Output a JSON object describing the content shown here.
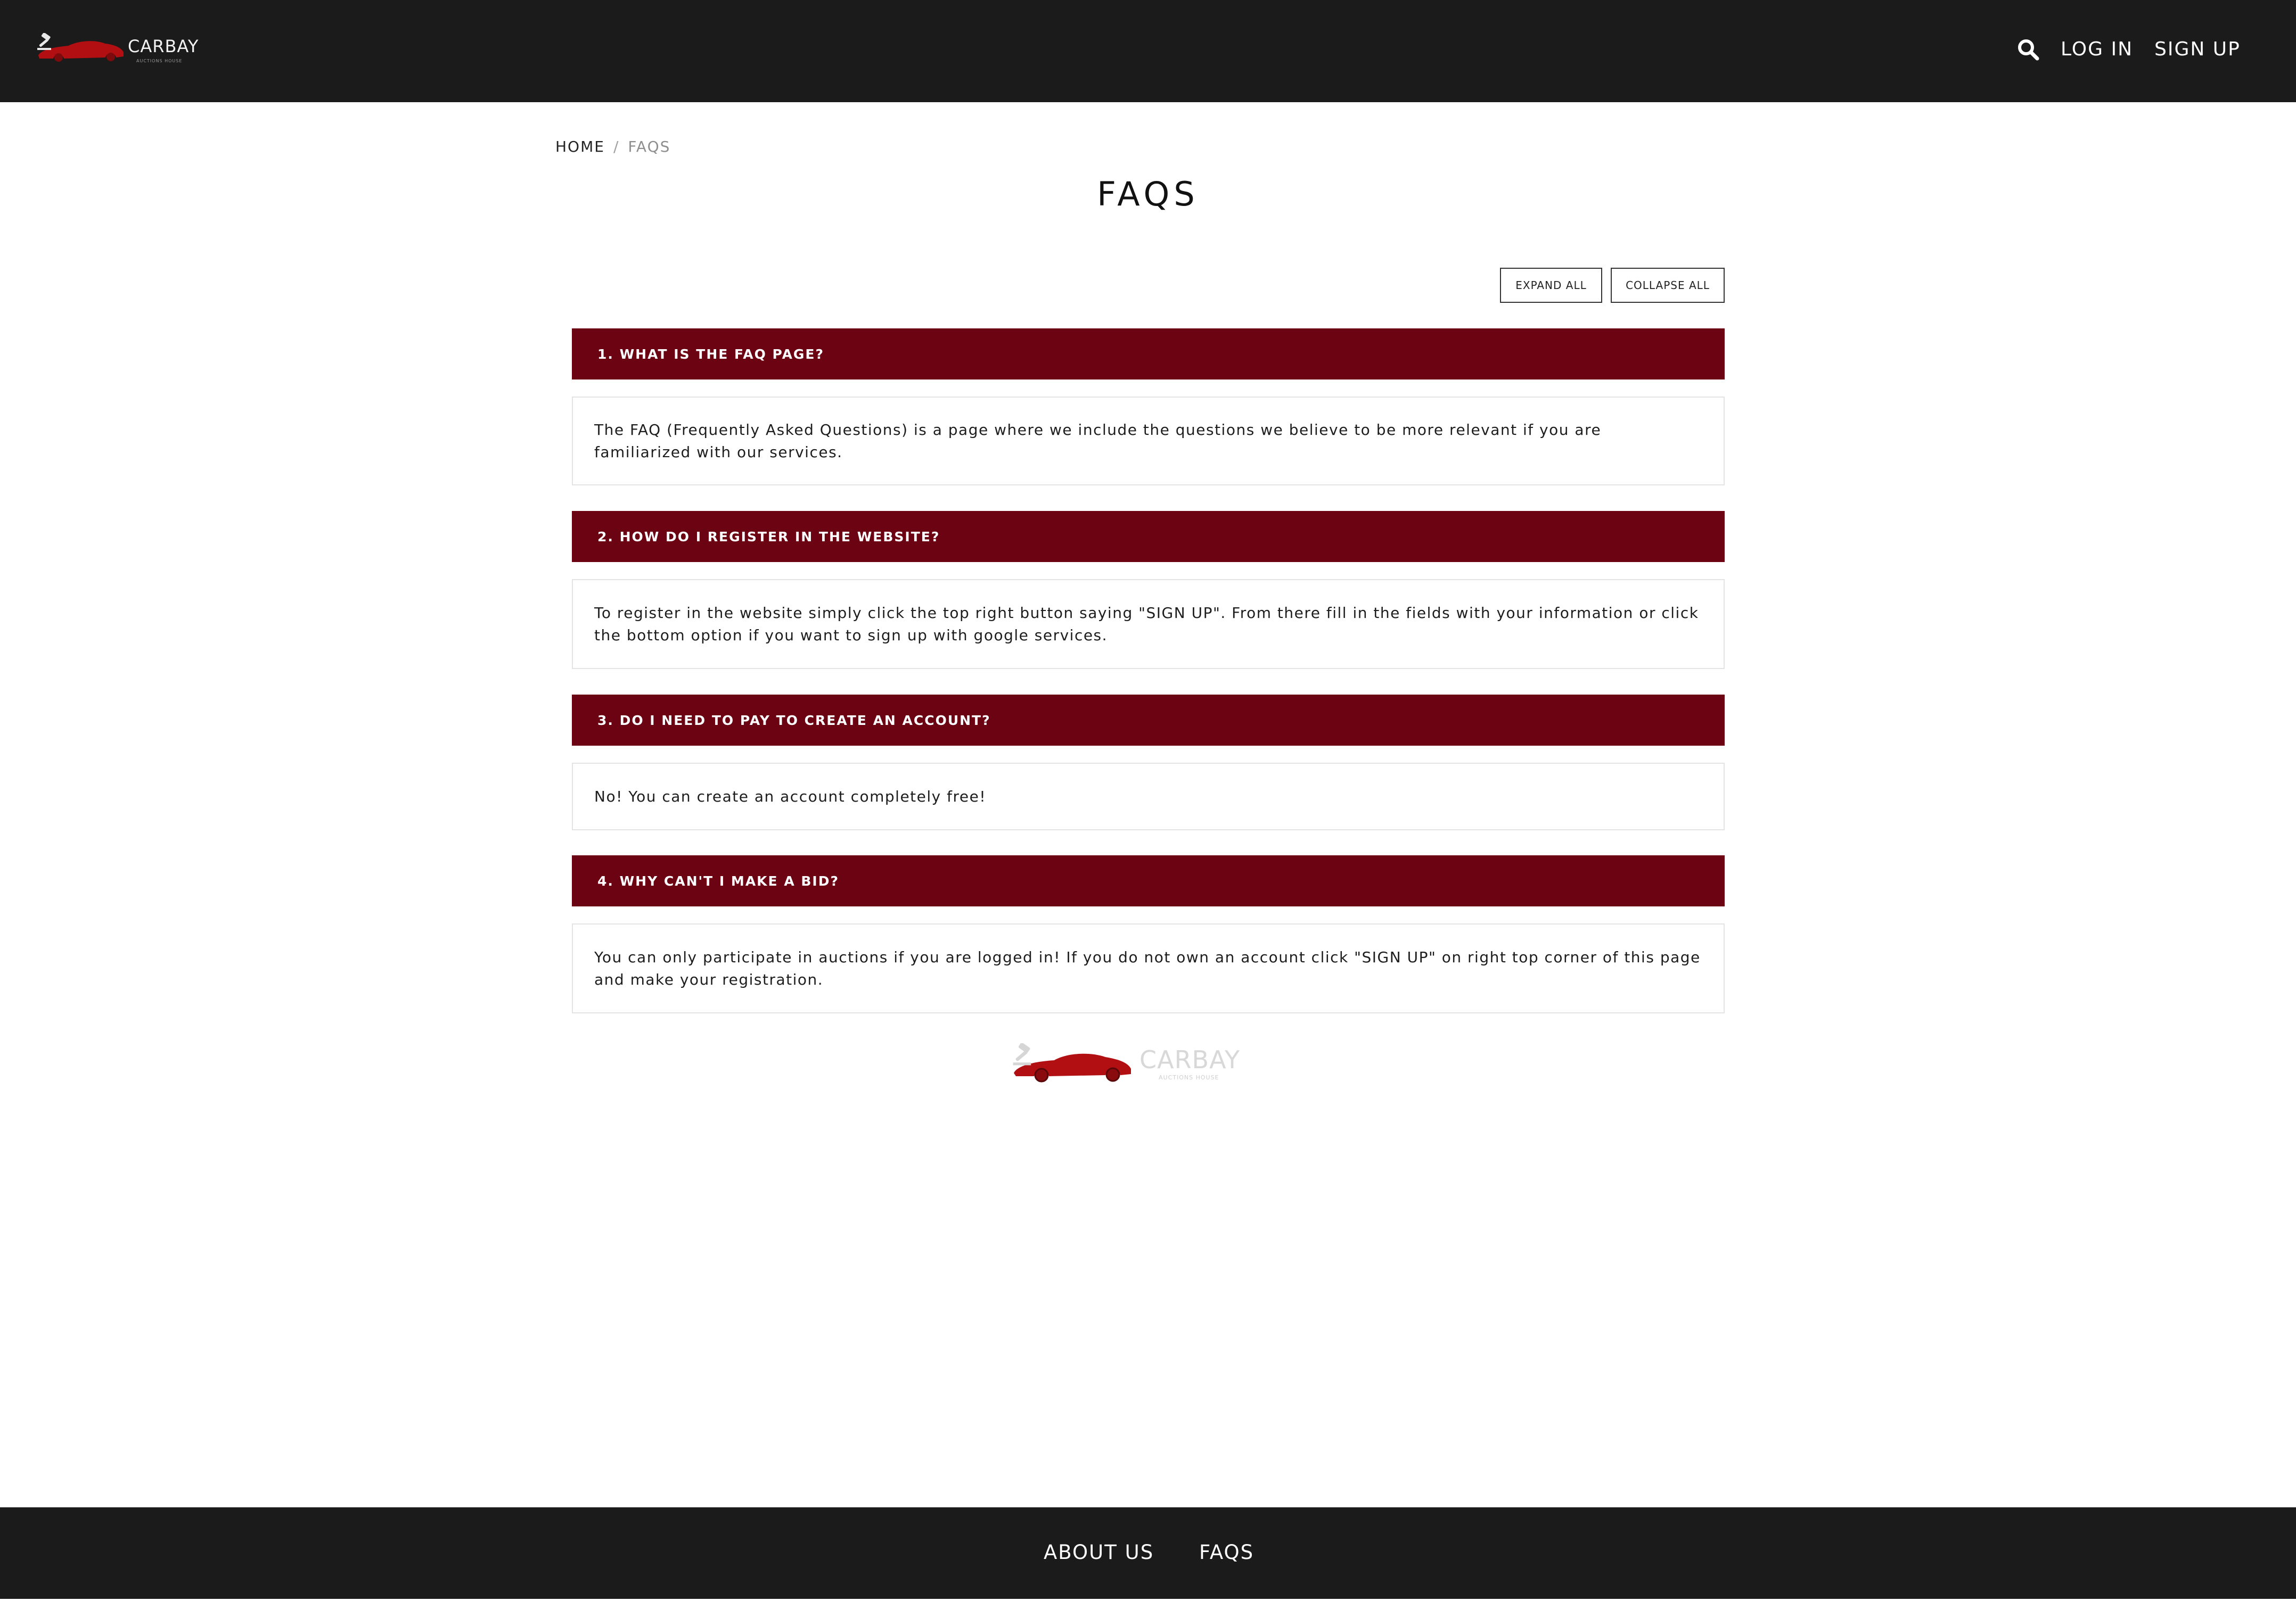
{
  "header": {
    "brand_name": "CARBAY",
    "brand_tagline": "AUCTIONS HOUSE",
    "nav": {
      "search_icon": "search-icon",
      "login_label": "LOG IN",
      "signup_label": "SIGN UP"
    }
  },
  "breadcrumb": {
    "home": "HOME",
    "separator": "/",
    "current": "FAQS"
  },
  "page_title": "FAQS",
  "controls": {
    "expand_all": "EXPAND ALL",
    "collapse_all": "COLLAPSE ALL"
  },
  "faqs": [
    {
      "question": "1. WHAT IS THE FAQ PAGE?",
      "answer": "The FAQ (Frequently Asked Questions) is a page where we include the questions we believe to be more relevant if you are familiarized with our services."
    },
    {
      "question": "2. HOW DO I REGISTER IN THE WEBSITE?",
      "answer": "To register in the website simply click the top right button saying \"SIGN UP\". From there fill in the fields with your information or click the bottom option if you want to sign up with google services."
    },
    {
      "question": "3. DO I NEED TO PAY TO CREATE AN ACCOUNT?",
      "answer": "No! You can create an account completely free!"
    },
    {
      "question": "4. WHY CAN'T I MAKE A BID?",
      "answer": "You can only participate in auctions if you are logged in! If you do not own an account click \"SIGN UP\" on right top corner of this page and make your registration."
    }
  ],
  "footer": {
    "about_us": "ABOUT US",
    "faqs": "FAQS"
  },
  "colors": {
    "header_bg": "#1b1b1b",
    "accent": "#6b0313",
    "car_red": "#b10f12"
  }
}
